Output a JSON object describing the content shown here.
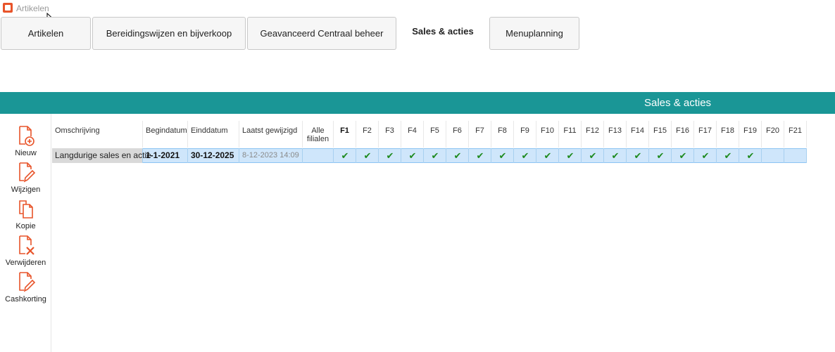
{
  "window": {
    "title": "Artikelen"
  },
  "tabs": [
    {
      "label": "Artikelen"
    },
    {
      "label": "Bereidingswijzen en bijverkoop"
    },
    {
      "label": "Geavanceerd Centraal beheer"
    },
    {
      "label": "Sales & acties"
    },
    {
      "label": "Menuplanning"
    }
  ],
  "section": {
    "title": "Sales & acties"
  },
  "sidebar": [
    {
      "label": "Nieuw",
      "icon": "document-add-icon"
    },
    {
      "label": "Wijzigen",
      "icon": "document-edit-icon"
    },
    {
      "label": "Kopie",
      "icon": "copy-icon"
    },
    {
      "label": "Verwijderen",
      "icon": "document-delete-icon"
    },
    {
      "label": "Cashkorting",
      "icon": "cash-discount-icon"
    }
  ],
  "table": {
    "headers": {
      "omschrijving": "Omschrijving",
      "begindatum": "Begindatum",
      "einddatum": "Einddatum",
      "laatst": "Laatst gewijzigd",
      "alle_line1": "Alle",
      "alle_line2": "filialen",
      "branches": [
        "F1",
        "F2",
        "F3",
        "F4",
        "F5",
        "F6",
        "F7",
        "F8",
        "F9",
        "F10",
        "F11",
        "F12",
        "F13",
        "F14",
        "F15",
        "F16",
        "F17",
        "F18",
        "F19",
        "F20",
        "F21"
      ]
    },
    "rows": [
      {
        "omschrijving": "Langdurige sales en actie",
        "begindatum": "1-1-2021",
        "einddatum": "30-12-2025",
        "laatst": "8-12-2023 14:09",
        "checks": [
          true,
          true,
          true,
          true,
          true,
          true,
          true,
          true,
          true,
          true,
          true,
          true,
          true,
          true,
          true,
          true,
          true,
          true,
          true,
          false,
          false
        ]
      }
    ]
  },
  "colors": {
    "accent": "#1a9696",
    "icon": "#e8542a",
    "check": "#1e8a1e",
    "selection": "#cfe6fb"
  }
}
